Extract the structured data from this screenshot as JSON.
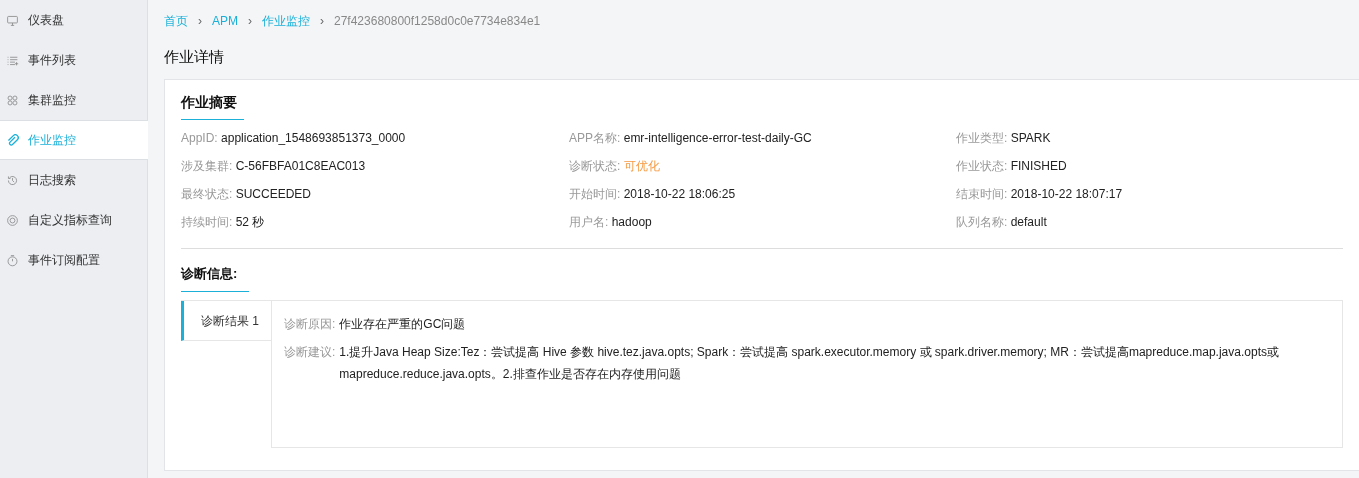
{
  "sidebar": {
    "items": [
      {
        "label": "仪表盘",
        "kind": "monitor",
        "selected": false
      },
      {
        "label": "事件列表",
        "kind": "list",
        "selected": false
      },
      {
        "label": "集群监控",
        "kind": "cluster",
        "selected": false
      },
      {
        "label": "作业监控",
        "kind": "clip",
        "selected": true
      },
      {
        "label": "日志搜索",
        "kind": "history",
        "selected": false
      },
      {
        "label": "自定义指标查询",
        "kind": "target",
        "selected": false
      },
      {
        "label": "事件订阅配置",
        "kind": "timer",
        "selected": false
      }
    ]
  },
  "breadcrumb": [
    {
      "label": "首页",
      "link": true
    },
    {
      "label": "APM",
      "link": true
    },
    {
      "label": "作业监控",
      "link": true
    },
    {
      "label": "27f423680800f1258d0c0e7734e834e1",
      "link": false
    }
  ],
  "breadcrumb_separator": "›",
  "page_title": "作业详情",
  "summary": {
    "title": "作业摘要",
    "fields": [
      {
        "label": "AppID:",
        "value": "application_1548693851373_0000",
        "highlight": false
      },
      {
        "label": "APP名称:",
        "value": "emr-intelligence-error-test-daily-GC",
        "highlight": false
      },
      {
        "label": "作业类型:",
        "value": "SPARK",
        "highlight": false
      },
      {
        "label": "涉及集群:",
        "value": "C-56FBFA01C8EAC013",
        "highlight": false
      },
      {
        "label": "诊断状态:",
        "value": "可优化",
        "highlight": true
      },
      {
        "label": "作业状态:",
        "value": "FINISHED",
        "highlight": false
      },
      {
        "label": "最终状态:",
        "value": "SUCCEEDED",
        "highlight": false
      },
      {
        "label": "开始时间:",
        "value": "2018-10-22 18:06:25",
        "highlight": false
      },
      {
        "label": "结束时间:",
        "value": "2018-10-22 18:07:17",
        "highlight": false
      },
      {
        "label": "持续时间:",
        "value": "52 秒",
        "highlight": false
      },
      {
        "label": "用户名:",
        "value": "hadoop",
        "highlight": false
      },
      {
        "label": "队列名称:",
        "value": "default",
        "highlight": false
      }
    ]
  },
  "diagnosis": {
    "title": "诊断信息:",
    "tabs": [
      {
        "label": "诊断结果 1",
        "selected": true
      }
    ],
    "entries": [
      {
        "label": "诊断原因:",
        "value": "作业存在严重的GC问题"
      },
      {
        "label": "诊断建议:",
        "value": "1.提升Java Heap Size:Tez：尝试提高 Hive 参数 hive.tez.java.opts; Spark：尝试提高 spark.executor.memory 或 spark.driver.memory; MR：尝试提高mapreduce.map.java.opts或mapreduce.reduce.java.opts。2.排查作业是否存在内存使用问题"
      }
    ]
  }
}
